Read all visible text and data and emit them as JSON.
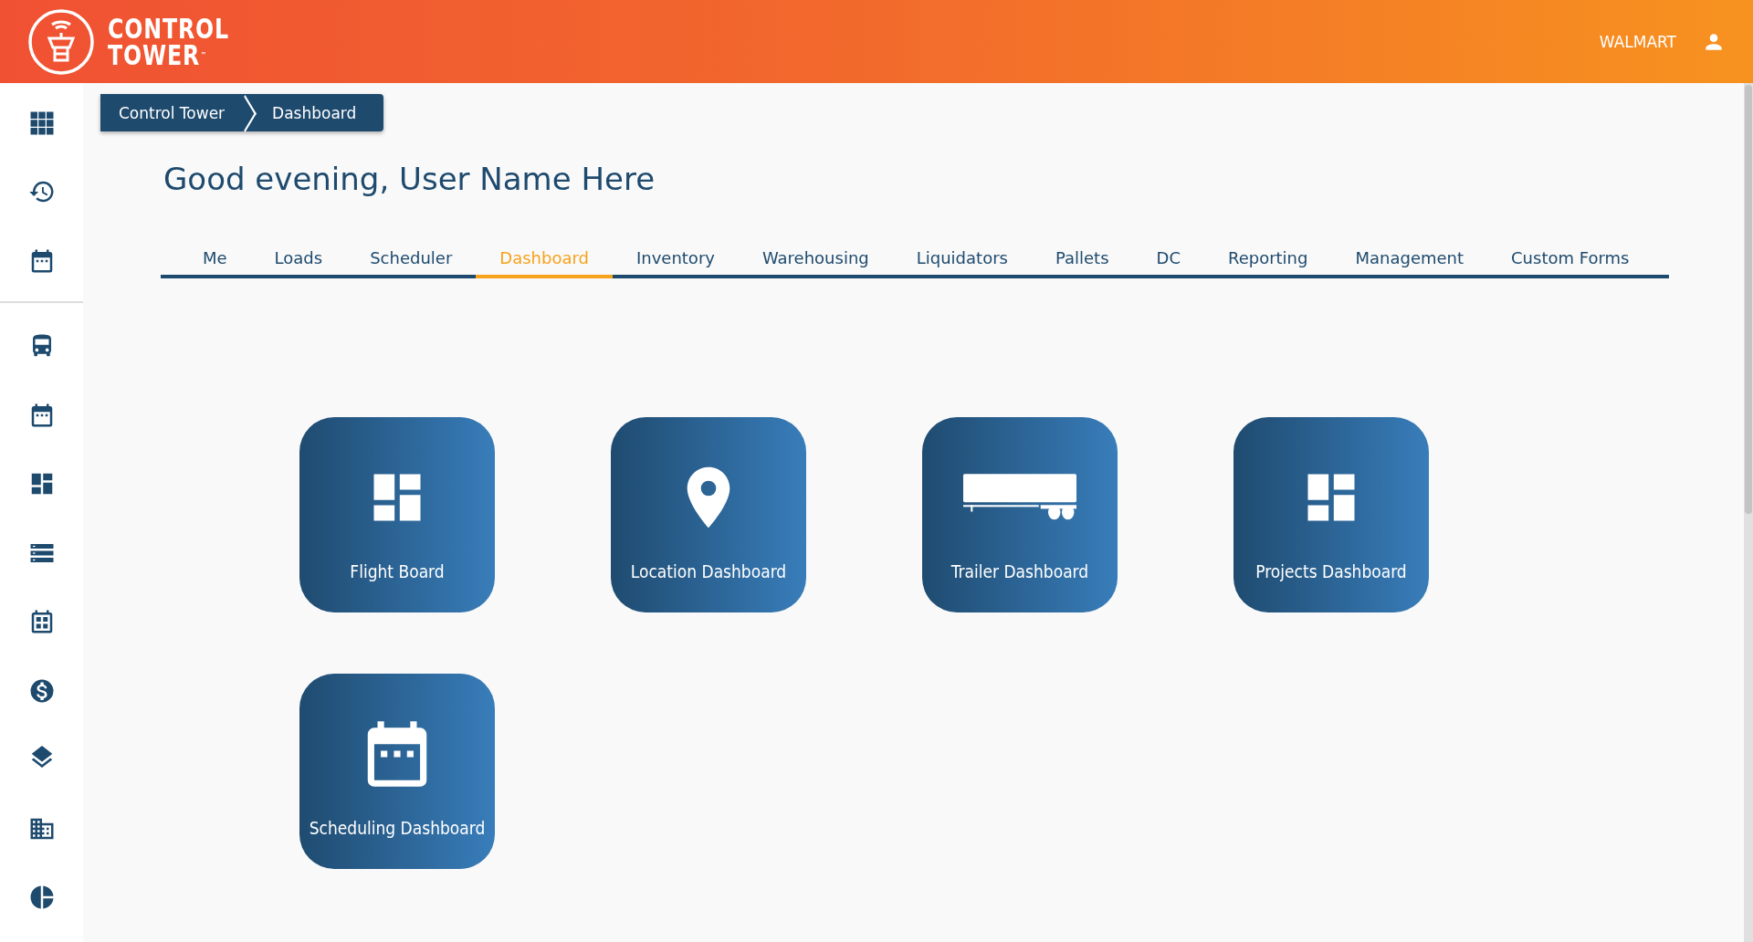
{
  "header": {
    "logo": {
      "line1": "CONTROL",
      "line2": "TOWER",
      "mark": "™"
    },
    "account": "WALMART"
  },
  "breadcrumb": [
    "Control Tower",
    "Dashboard"
  ],
  "greeting": "Good evening, User Name Here",
  "tabs": [
    {
      "label": "Me",
      "selected": false
    },
    {
      "label": "Loads",
      "selected": false
    },
    {
      "label": "Scheduler",
      "selected": false
    },
    {
      "label": "Dashboard",
      "selected": true
    },
    {
      "label": "Inventory",
      "selected": false
    },
    {
      "label": "Warehousing",
      "selected": false
    },
    {
      "label": "Liquidators",
      "selected": false
    },
    {
      "label": "Pallets",
      "selected": false
    },
    {
      "label": "DC",
      "selected": false
    },
    {
      "label": "Reporting",
      "selected": false
    },
    {
      "label": "Management",
      "selected": false
    },
    {
      "label": "Custom Forms",
      "selected": false
    }
  ],
  "tiles": [
    {
      "label": "Flight Board"
    },
    {
      "label": "Location Dashboard"
    },
    {
      "label": "Trailer Dashboard"
    },
    {
      "label": "Projects Dashboard"
    },
    {
      "label": "Scheduling Dashboard"
    }
  ]
}
